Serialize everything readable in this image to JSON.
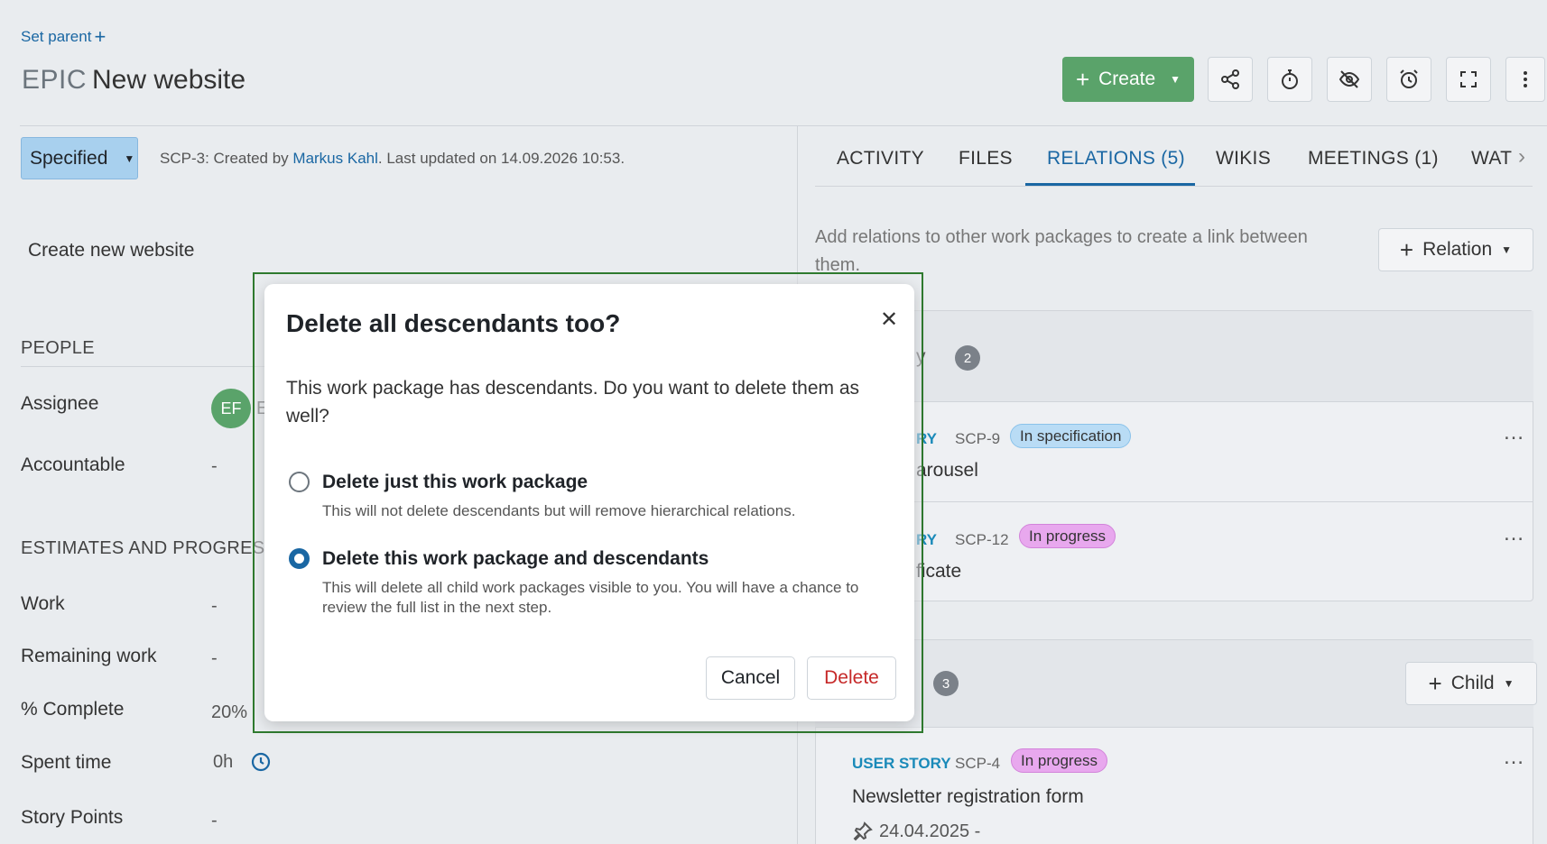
{
  "header": {
    "set_parent": "Set parent",
    "type": "EPIC",
    "title": "New website",
    "create_label": "Create"
  },
  "status": {
    "label": "Specified"
  },
  "meta": {
    "prefix": "SCP-3: Created by ",
    "author": "Markus Kahl",
    "suffix": ". Last updated on 14.09.2026 10:53."
  },
  "description": "Create new website",
  "sections": {
    "people": {
      "heading": "PEOPLE",
      "assignee_label": "Assignee",
      "assignee_initials": "EF",
      "assignee_name_fragment": "E",
      "accountable_label": "Accountable",
      "accountable_value": "-"
    },
    "estimates": {
      "heading": "ESTIMATES AND PROGRESS",
      "work_label": "Work",
      "work_value": "-",
      "remaining_label": "Remaining work",
      "remaining_value": "-",
      "complete_label": "% Complete",
      "complete_value": "20%",
      "spent_label": "Spent time",
      "spent_value": "0h",
      "story_label": "Story Points",
      "story_value": "-"
    }
  },
  "tabs": {
    "activity": "ACTIVITY",
    "files": "FILES",
    "relations": "RELATIONS (5)",
    "wikis": "WIKIS",
    "meetings": "MEETINGS (1)",
    "watchers": "WAT"
  },
  "relations": {
    "description": "Add relations to other work packages to create a link between them.",
    "relation_button": "Relation",
    "group1_fragment": "y",
    "group1_count": "2",
    "rows": [
      {
        "type": "RY",
        "id": "SCP-9",
        "status": "In specification",
        "title_fragment": "arousel"
      },
      {
        "type": "RY",
        "id": "SCP-12",
        "status": "In progress",
        "title_fragment": "ficate"
      }
    ],
    "group2_count": "3",
    "child_button": "Child",
    "child_row": {
      "type": "USER STORY",
      "id": "SCP-4",
      "status": "In progress",
      "title": "Newsletter registration form",
      "date": "24.04.2025 -"
    },
    "more": "…"
  },
  "modal": {
    "title": "Delete all descendants too?",
    "body": "This work package has descendants. Do you want to delete them as well?",
    "option1_label": "Delete just this work package",
    "option1_hint": "This will not delete descendants but will remove hierarchical relations.",
    "option2_label": "Delete this work package and descendants",
    "option2_hint": "This will delete all child work packages visible to you. You will have a chance to review the full list in the next step.",
    "cancel": "Cancel",
    "delete": "Delete",
    "selected_option": "option2"
  },
  "colors": {
    "accent": "#1a67a3",
    "create_green": "#5aa36a",
    "status_blue": "#a8d0ee",
    "in_progress_purple": "#e8a8ee",
    "focus_frame": "#2f7a2f",
    "delete_red": "#c62828"
  },
  "icons": {
    "share": "share-icon",
    "timer": "stopwatch-icon",
    "watch": "eye-slash-icon",
    "reminder": "alarm-clock-icon",
    "fullscreen": "expand-icon",
    "more": "kebab-menu-icon"
  }
}
